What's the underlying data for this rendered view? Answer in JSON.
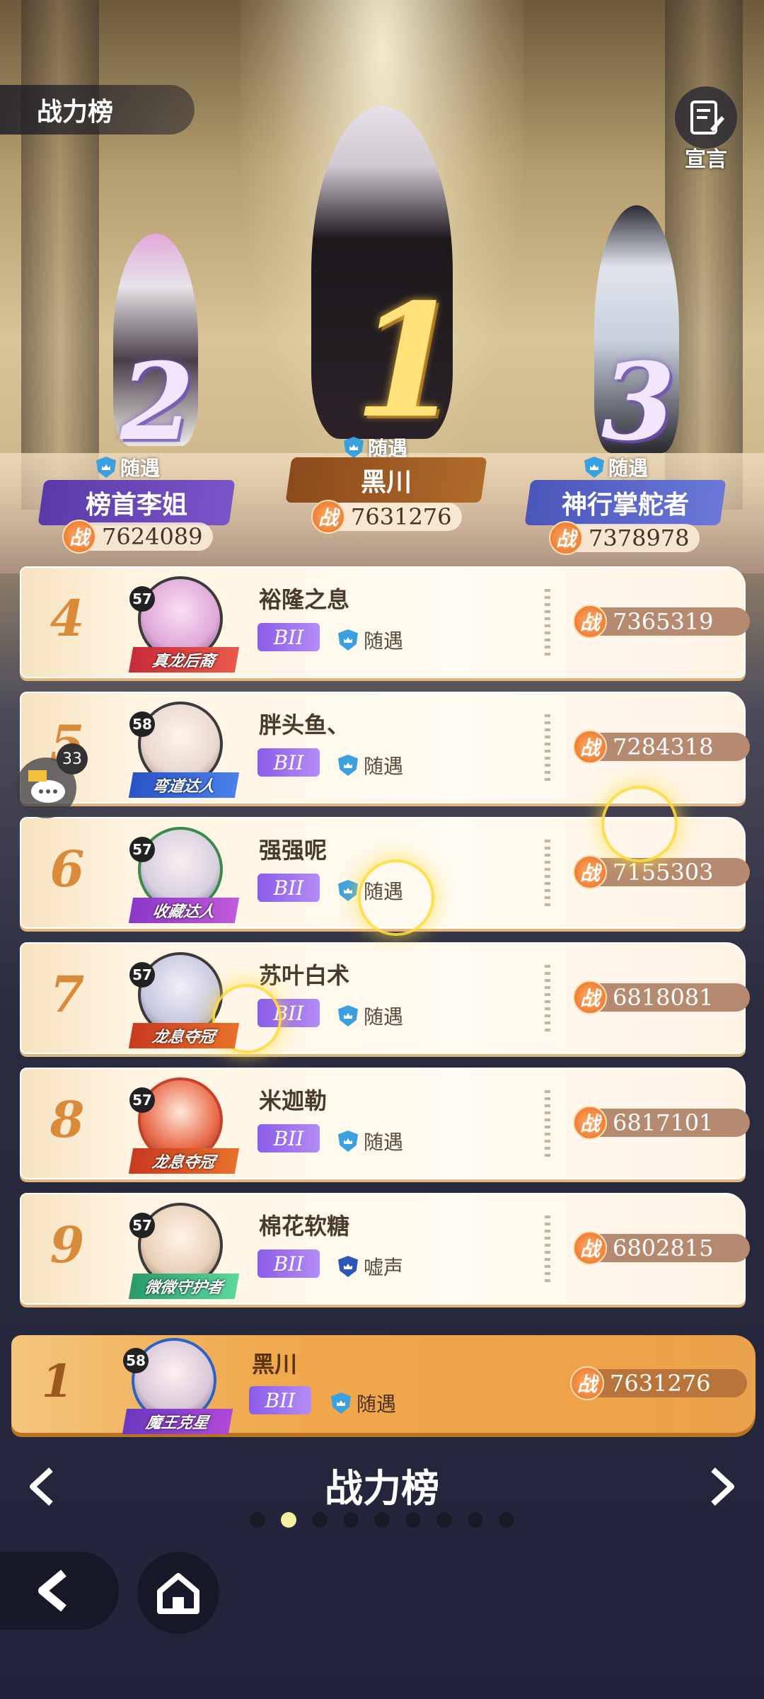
{
  "header": {
    "title": "战力榜",
    "declare_label": "宣言"
  },
  "podium": [
    {
      "rank": "2",
      "name": "榜首李姐",
      "guild": "随遇",
      "power": "7624089"
    },
    {
      "rank": "1",
      "name": "黑川",
      "guild": "随遇",
      "power": "7631276"
    },
    {
      "rank": "3",
      "name": "神行掌舵者",
      "guild": "随遇",
      "power": "7378978"
    }
  ],
  "power_label": "战",
  "rows": [
    {
      "rank": "4",
      "level": "57",
      "title": "真龙后裔",
      "name": "裕隆之息",
      "tier": "BII",
      "guild": "随遇",
      "power": "7365319"
    },
    {
      "rank": "5",
      "level": "58",
      "title": "弯道达人",
      "name": "胖头鱼、",
      "tier": "BII",
      "guild": "随遇",
      "power": "7284318"
    },
    {
      "rank": "6",
      "level": "57",
      "title": "收藏达人",
      "name": "强强呢",
      "tier": "BII",
      "guild": "随遇",
      "power": "7155303"
    },
    {
      "rank": "7",
      "level": "57",
      "title": "龙息夺冠",
      "name": "苏叶白术",
      "tier": "BII",
      "guild": "随遇",
      "power": "6818081"
    },
    {
      "rank": "8",
      "level": "57",
      "title": "龙息夺冠",
      "name": "米迦勒",
      "tier": "BII",
      "guild": "随遇",
      "power": "6817101"
    },
    {
      "rank": "9",
      "level": "57",
      "title": "微微守护者",
      "name": "棉花软糖",
      "tier": "BII",
      "guild": "嘘声",
      "power": "6802815"
    }
  ],
  "me": {
    "rank": "1",
    "level": "58",
    "title": "魔王克星",
    "name": "黑川",
    "tier": "BII",
    "guild": "随遇",
    "power": "7631276"
  },
  "chat": {
    "count": "33"
  },
  "nav": {
    "title": "战力榜",
    "page_count": 9,
    "active_page": 2
  },
  "colors": {
    "accent": "#f0a248",
    "power_badge": "#e86a20",
    "tier": "#8b5ce8",
    "guild_shield": "#3aa0e0"
  }
}
